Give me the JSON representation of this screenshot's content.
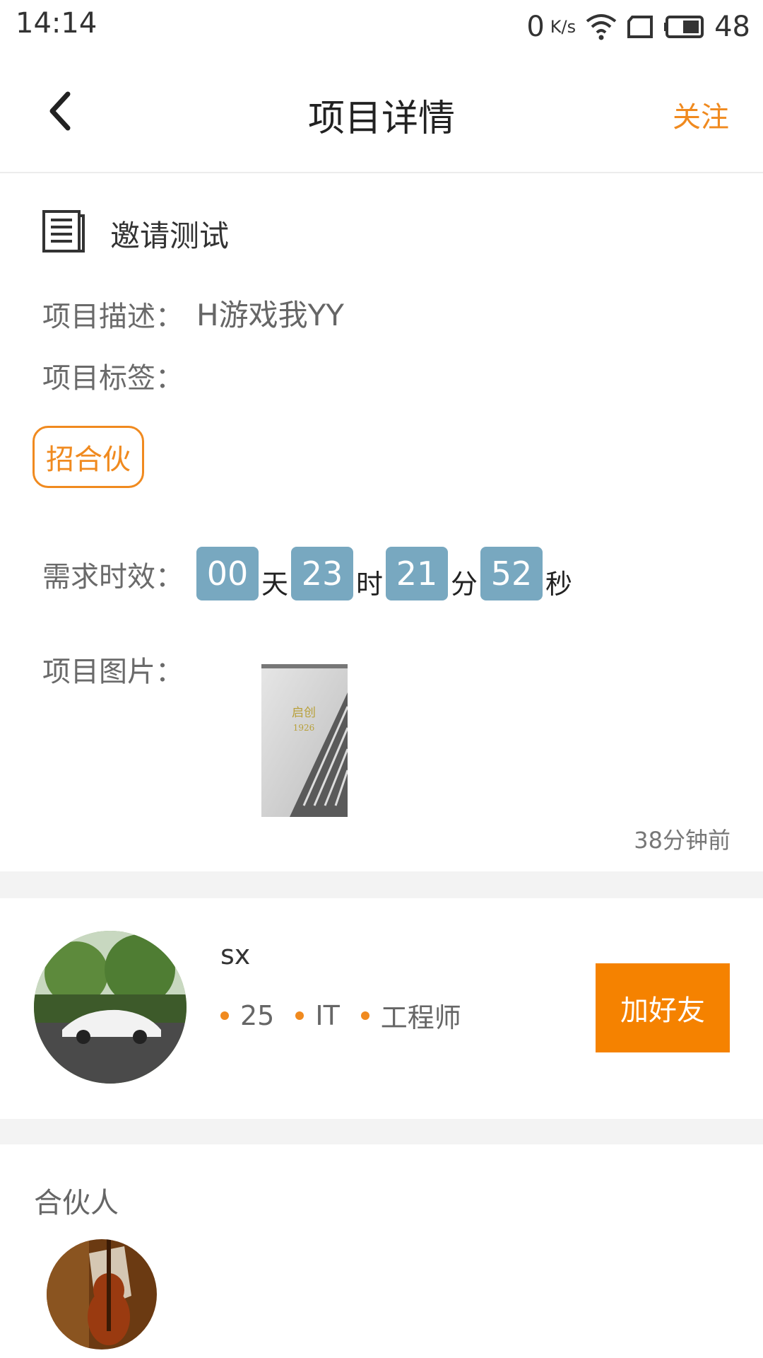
{
  "status_bar": {
    "time": "14:14",
    "net_speed_value": "0",
    "net_speed_unit": "K/s",
    "battery": "48"
  },
  "header": {
    "title": "项目详情",
    "follow_label": "关注"
  },
  "project": {
    "name": "邀请测试",
    "description_label": "项目描述：",
    "description_value": "H游戏我YY",
    "tags_label": "项目标签：",
    "tag": "招合伙",
    "timer_label": "需求时效：",
    "timer": {
      "days": "00",
      "days_unit": "天",
      "hours": "23",
      "hours_unit": "时",
      "minutes": "21",
      "minutes_unit": "分",
      "seconds": "52",
      "seconds_unit": "秒"
    },
    "images_label": "项目图片：",
    "image_text_line1": "启创",
    "image_text_line2": "1926",
    "time_ago": "38分钟前"
  },
  "user": {
    "name": "sx",
    "age": "25",
    "industry": "IT",
    "job": "工程师",
    "add_friend_label": "加好友"
  },
  "partners": {
    "title": "合伙人"
  },
  "colors": {
    "accent": "#f08a1f",
    "button": "#f58200",
    "timer_box": "#78a8c0"
  }
}
